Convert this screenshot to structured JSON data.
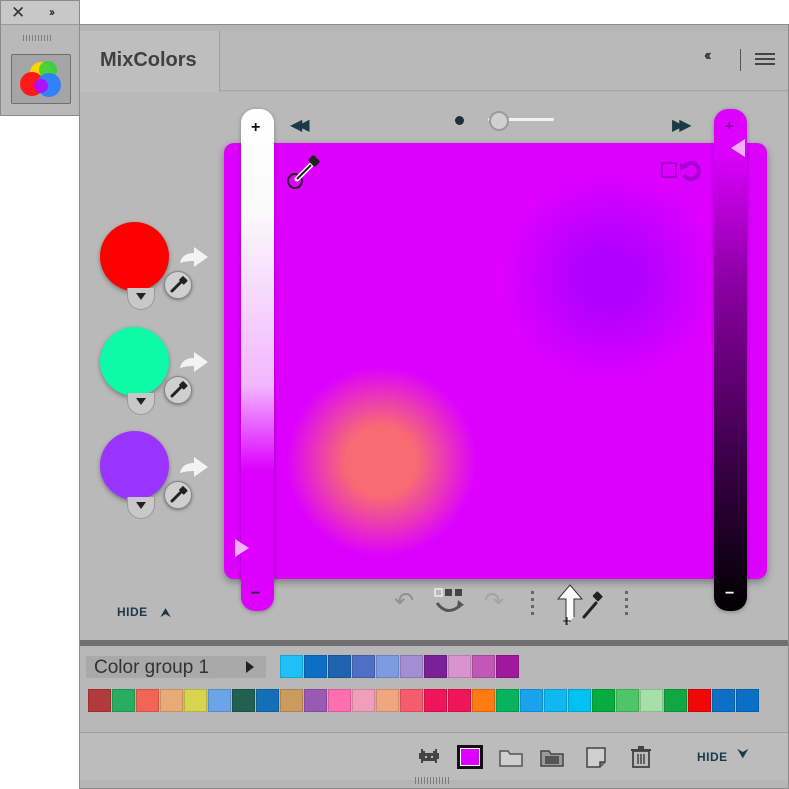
{
  "dock": {
    "close_icon": "close-icon",
    "expand_icon": "expand-icon",
    "app_icon": "color-wheel-icon",
    "close_glyph": "✕",
    "expand_glyph": "››"
  },
  "panel": {
    "title": "MixColors",
    "collapse_glyph": "‹‹"
  },
  "mixer": {
    "current_color": "#dd00ff",
    "plus_label": "+",
    "minus_label": "−",
    "rewind_glyph": "◀◀",
    "ffwd_glyph": "▶▶",
    "brush_size_level": 0.1,
    "source_colors": [
      {
        "color": "#ff0000"
      },
      {
        "color": "#0dfba8"
      },
      {
        "color": "#9933ff"
      }
    ],
    "hide_label": "HIDE",
    "hide_glyph": "⮝",
    "undo_glyph": "↶",
    "redo_glyph": "↷"
  },
  "swatches": {
    "group_name": "Color group 1",
    "row1": [
      "#1ec0f7",
      "#0c6fc4",
      "#1f62ad",
      "#4f6fc4",
      "#7d9cdf",
      "#a38ed3",
      "#7b2197",
      "#d994cf",
      "#c257b7",
      "#a0199c"
    ],
    "row2": [
      "#b23a3a",
      "#27ae60",
      "#f16456",
      "#e8ab76",
      "#d8d44e",
      "#6aa5e8",
      "#226151",
      "#1370b6",
      "#c99b5d",
      "#9b59b6",
      "#ff6eb0",
      "#f19eba",
      "#f0a77f",
      "#f55c6e",
      "#f0145a",
      "#f0145a",
      "#ff7a12",
      "#07b45d",
      "#1aa3ec",
      "#0fb8f0",
      "#00c2f0",
      "#05ac3e",
      "#4ec566",
      "#a4e0a8",
      "#11a844",
      "#f00808",
      "#0c70c6",
      "#0a70c6"
    ]
  },
  "footer": {
    "hide_label": "HIDE",
    "hide_glyph": "⮟",
    "icons": [
      "invader-icon",
      "fill-color-icon",
      "folder-icon",
      "folder-open-icon",
      "new-swatch-icon",
      "trash-icon"
    ]
  }
}
